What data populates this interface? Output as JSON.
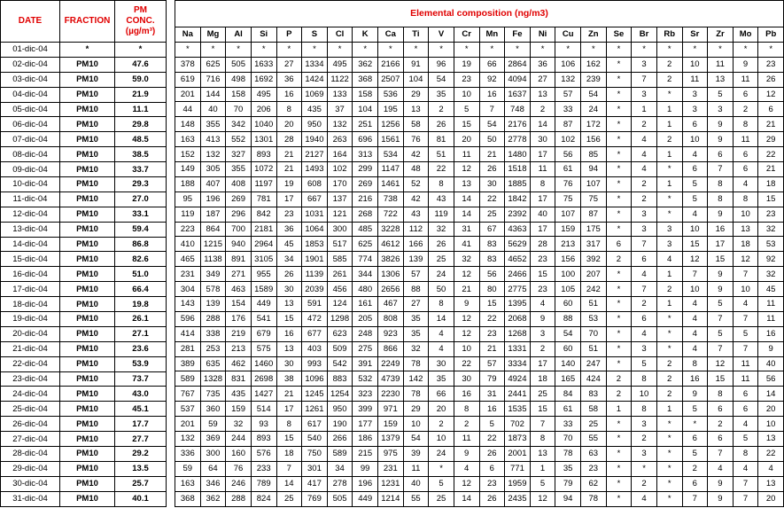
{
  "left_headers": {
    "date": "DATE",
    "fraction": "FRACTION",
    "pm_conc_line1": "PM",
    "pm_conc_line2": "CONC.",
    "pm_conc_unit": "(µg/m³)"
  },
  "title": "Elemental composition (ng/m3)",
  "elements": [
    "Na",
    "Mg",
    "Al",
    "Si",
    "P",
    "S",
    "Cl",
    "K",
    "Ca",
    "Ti",
    "V",
    "Cr",
    "Mn",
    "Fe",
    "Ni",
    "Cu",
    "Zn",
    "Se",
    "Br",
    "Rb",
    "Sr",
    "Zr",
    "Mo",
    "Pb"
  ],
  "rows": [
    {
      "date": "01-dic-04",
      "fraction": "*",
      "pm": "*",
      "values": [
        "*",
        "*",
        "*",
        "*",
        "*",
        "*",
        "*",
        "*",
        "*",
        "*",
        "*",
        "*",
        "*",
        "*",
        "*",
        "*",
        "*",
        "*",
        "*",
        "*",
        "*",
        "*",
        "*",
        "*"
      ]
    },
    {
      "date": "02-dic-04",
      "fraction": "PM10",
      "pm": "47.6",
      "values": [
        "378",
        "625",
        "505",
        "1633",
        "27",
        "1334",
        "495",
        "362",
        "2166",
        "91",
        "96",
        "19",
        "66",
        "2864",
        "36",
        "106",
        "162",
        "*",
        "3",
        "2",
        "10",
        "11",
        "9",
        "23"
      ]
    },
    {
      "date": "03-dic-04",
      "fraction": "PM10",
      "pm": "59.0",
      "values": [
        "619",
        "716",
        "498",
        "1692",
        "36",
        "1424",
        "1122",
        "368",
        "2507",
        "104",
        "54",
        "23",
        "92",
        "4094",
        "27",
        "132",
        "239",
        "*",
        "7",
        "2",
        "11",
        "13",
        "11",
        "26"
      ]
    },
    {
      "date": "04-dic-04",
      "fraction": "PM10",
      "pm": "21.9",
      "values": [
        "201",
        "144",
        "158",
        "495",
        "16",
        "1069",
        "133",
        "158",
        "536",
        "29",
        "35",
        "10",
        "16",
        "1637",
        "13",
        "57",
        "54",
        "*",
        "3",
        "*",
        "3",
        "5",
        "6",
        "12"
      ]
    },
    {
      "date": "05-dic-04",
      "fraction": "PM10",
      "pm": "11.1",
      "values": [
        "44",
        "40",
        "70",
        "206",
        "8",
        "435",
        "37",
        "104",
        "195",
        "13",
        "2",
        "5",
        "7",
        "748",
        "2",
        "33",
        "24",
        "*",
        "1",
        "1",
        "3",
        "3",
        "2",
        "6"
      ]
    },
    {
      "date": "06-dic-04",
      "fraction": "PM10",
      "pm": "29.8",
      "values": [
        "148",
        "355",
        "342",
        "1040",
        "20",
        "950",
        "132",
        "251",
        "1256",
        "58",
        "26",
        "15",
        "54",
        "2176",
        "14",
        "87",
        "172",
        "*",
        "2",
        "1",
        "6",
        "9",
        "8",
        "21"
      ]
    },
    {
      "date": "07-dic-04",
      "fraction": "PM10",
      "pm": "48.5",
      "values": [
        "163",
        "413",
        "552",
        "1301",
        "28",
        "1940",
        "263",
        "696",
        "1561",
        "76",
        "81",
        "20",
        "50",
        "2778",
        "30",
        "102",
        "156",
        "*",
        "4",
        "2",
        "10",
        "9",
        "11",
        "29"
      ]
    },
    {
      "date": "08-dic-04",
      "fraction": "PM10",
      "pm": "38.5",
      "values": [
        "152",
        "132",
        "327",
        "893",
        "21",
        "2127",
        "164",
        "313",
        "534",
        "42",
        "51",
        "11",
        "21",
        "1480",
        "17",
        "56",
        "85",
        "*",
        "4",
        "1",
        "4",
        "6",
        "6",
        "22"
      ]
    },
    {
      "date": "09-dic-04",
      "fraction": "PM10",
      "pm": "33.7",
      "values": [
        "149",
        "305",
        "355",
        "1072",
        "21",
        "1493",
        "102",
        "299",
        "1147",
        "48",
        "22",
        "12",
        "26",
        "1518",
        "11",
        "61",
        "94",
        "*",
        "4",
        "*",
        "6",
        "7",
        "6",
        "21"
      ]
    },
    {
      "date": "10-dic-04",
      "fraction": "PM10",
      "pm": "29.3",
      "values": [
        "188",
        "407",
        "408",
        "1197",
        "19",
        "608",
        "170",
        "269",
        "1461",
        "52",
        "8",
        "13",
        "30",
        "1885",
        "8",
        "76",
        "107",
        "*",
        "2",
        "1",
        "5",
        "8",
        "4",
        "18"
      ]
    },
    {
      "date": "11-dic-04",
      "fraction": "PM10",
      "pm": "27.0",
      "values": [
        "95",
        "196",
        "269",
        "781",
        "17",
        "667",
        "137",
        "216",
        "738",
        "42",
        "43",
        "14",
        "22",
        "1842",
        "17",
        "75",
        "75",
        "*",
        "2",
        "*",
        "5",
        "8",
        "8",
        "15"
      ]
    },
    {
      "date": "12-dic-04",
      "fraction": "PM10",
      "pm": "33.1",
      "values": [
        "119",
        "187",
        "296",
        "842",
        "23",
        "1031",
        "121",
        "268",
        "722",
        "43",
        "119",
        "14",
        "25",
        "2392",
        "40",
        "107",
        "87",
        "*",
        "3",
        "*",
        "4",
        "9",
        "10",
        "23"
      ]
    },
    {
      "date": "13-dic-04",
      "fraction": "PM10",
      "pm": "59.4",
      "values": [
        "223",
        "864",
        "700",
        "2181",
        "36",
        "1064",
        "300",
        "485",
        "3228",
        "112",
        "32",
        "31",
        "67",
        "4363",
        "17",
        "159",
        "175",
        "*",
        "3",
        "3",
        "10",
        "16",
        "13",
        "32"
      ]
    },
    {
      "date": "14-dic-04",
      "fraction": "PM10",
      "pm": "86.8",
      "values": [
        "410",
        "1215",
        "940",
        "2964",
        "45",
        "1853",
        "517",
        "625",
        "4612",
        "166",
        "26",
        "41",
        "83",
        "5629",
        "28",
        "213",
        "317",
        "6",
        "7",
        "3",
        "15",
        "17",
        "18",
        "53"
      ]
    },
    {
      "date": "15-dic-04",
      "fraction": "PM10",
      "pm": "82.6",
      "values": [
        "465",
        "1138",
        "891",
        "3105",
        "34",
        "1901",
        "585",
        "774",
        "3826",
        "139",
        "25",
        "32",
        "83",
        "4652",
        "23",
        "156",
        "392",
        "2",
        "6",
        "4",
        "12",
        "15",
        "12",
        "92"
      ]
    },
    {
      "date": "16-dic-04",
      "fraction": "PM10",
      "pm": "51.0",
      "values": [
        "231",
        "349",
        "271",
        "955",
        "26",
        "1139",
        "261",
        "344",
        "1306",
        "57",
        "24",
        "12",
        "56",
        "2466",
        "15",
        "100",
        "207",
        "*",
        "4",
        "1",
        "7",
        "9",
        "7",
        "32"
      ]
    },
    {
      "date": "17-dic-04",
      "fraction": "PM10",
      "pm": "66.4",
      "values": [
        "304",
        "578",
        "463",
        "1589",
        "30",
        "2039",
        "456",
        "480",
        "2656",
        "88",
        "50",
        "21",
        "80",
        "2775",
        "23",
        "105",
        "242",
        "*",
        "7",
        "2",
        "10",
        "9",
        "10",
        "45"
      ]
    },
    {
      "date": "18-dic-04",
      "fraction": "PM10",
      "pm": "19.8",
      "values": [
        "143",
        "139",
        "154",
        "449",
        "13",
        "591",
        "124",
        "161",
        "467",
        "27",
        "8",
        "9",
        "15",
        "1395",
        "4",
        "60",
        "51",
        "*",
        "2",
        "1",
        "4",
        "5",
        "4",
        "11"
      ]
    },
    {
      "date": "19-dic-04",
      "fraction": "PM10",
      "pm": "26.1",
      "values": [
        "596",
        "288",
        "176",
        "541",
        "15",
        "472",
        "1298",
        "205",
        "808",
        "35",
        "14",
        "12",
        "22",
        "2068",
        "9",
        "88",
        "53",
        "*",
        "6",
        "*",
        "4",
        "7",
        "7",
        "11"
      ]
    },
    {
      "date": "20-dic-04",
      "fraction": "PM10",
      "pm": "27.1",
      "values": [
        "414",
        "338",
        "219",
        "679",
        "16",
        "677",
        "623",
        "248",
        "923",
        "35",
        "4",
        "12",
        "23",
        "1268",
        "3",
        "54",
        "70",
        "*",
        "4",
        "*",
        "4",
        "5",
        "5",
        "16"
      ]
    },
    {
      "date": "21-dic-04",
      "fraction": "PM10",
      "pm": "23.6",
      "values": [
        "281",
        "253",
        "213",
        "575",
        "13",
        "403",
        "509",
        "275",
        "866",
        "32",
        "4",
        "10",
        "21",
        "1331",
        "2",
        "60",
        "51",
        "*",
        "3",
        "*",
        "4",
        "7",
        "7",
        "9"
      ]
    },
    {
      "date": "22-dic-04",
      "fraction": "PM10",
      "pm": "53.9",
      "values": [
        "389",
        "635",
        "462",
        "1460",
        "30",
        "993",
        "542",
        "391",
        "2249",
        "78",
        "30",
        "22",
        "57",
        "3334",
        "17",
        "140",
        "247",
        "*",
        "5",
        "2",
        "8",
        "12",
        "11",
        "40"
      ]
    },
    {
      "date": "23-dic-04",
      "fraction": "PM10",
      "pm": "73.7",
      "values": [
        "589",
        "1328",
        "831",
        "2698",
        "38",
        "1096",
        "883",
        "532",
        "4739",
        "142",
        "35",
        "30",
        "79",
        "4924",
        "18",
        "165",
        "424",
        "2",
        "8",
        "2",
        "16",
        "15",
        "11",
        "56"
      ]
    },
    {
      "date": "24-dic-04",
      "fraction": "PM10",
      "pm": "43.0",
      "values": [
        "767",
        "735",
        "435",
        "1427",
        "21",
        "1245",
        "1254",
        "323",
        "2230",
        "78",
        "66",
        "16",
        "31",
        "2441",
        "25",
        "84",
        "83",
        "2",
        "10",
        "2",
        "9",
        "8",
        "6",
        "14"
      ]
    },
    {
      "date": "25-dic-04",
      "fraction": "PM10",
      "pm": "45.1",
      "values": [
        "537",
        "360",
        "159",
        "514",
        "17",
        "1261",
        "950",
        "399",
        "971",
        "29",
        "20",
        "8",
        "16",
        "1535",
        "15",
        "61",
        "58",
        "1",
        "8",
        "1",
        "5",
        "6",
        "6",
        "20"
      ]
    },
    {
      "date": "26-dic-04",
      "fraction": "PM10",
      "pm": "17.7",
      "values": [
        "201",
        "59",
        "32",
        "93",
        "8",
        "617",
        "190",
        "177",
        "159",
        "10",
        "2",
        "2",
        "5",
        "702",
        "7",
        "33",
        "25",
        "*",
        "3",
        "*",
        "*",
        "2",
        "4",
        "10"
      ]
    },
    {
      "date": "27-dic-04",
      "fraction": "PM10",
      "pm": "27.7",
      "values": [
        "132",
        "369",
        "244",
        "893",
        "15",
        "540",
        "266",
        "186",
        "1379",
        "54",
        "10",
        "11",
        "22",
        "1873",
        "8",
        "70",
        "55",
        "*",
        "2",
        "*",
        "6",
        "6",
        "5",
        "13"
      ]
    },
    {
      "date": "28-dic-04",
      "fraction": "PM10",
      "pm": "29.2",
      "values": [
        "336",
        "300",
        "160",
        "576",
        "18",
        "750",
        "589",
        "215",
        "975",
        "39",
        "24",
        "9",
        "26",
        "2001",
        "13",
        "78",
        "63",
        "*",
        "3",
        "*",
        "5",
        "7",
        "8",
        "22"
      ]
    },
    {
      "date": "29-dic-04",
      "fraction": "PM10",
      "pm": "13.5",
      "values": [
        "59",
        "64",
        "76",
        "233",
        "7",
        "301",
        "34",
        "99",
        "231",
        "11",
        "*",
        "4",
        "6",
        "771",
        "1",
        "35",
        "23",
        "*",
        "*",
        "*",
        "2",
        "4",
        "4",
        "4"
      ]
    },
    {
      "date": "30-dic-04",
      "fraction": "PM10",
      "pm": "25.7",
      "values": [
        "163",
        "346",
        "246",
        "789",
        "14",
        "417",
        "278",
        "196",
        "1231",
        "40",
        "5",
        "12",
        "23",
        "1959",
        "5",
        "79",
        "62",
        "*",
        "2",
        "*",
        "6",
        "9",
        "7",
        "13"
      ]
    },
    {
      "date": "31-dic-04",
      "fraction": "PM10",
      "pm": "40.1",
      "values": [
        "368",
        "362",
        "288",
        "824",
        "25",
        "769",
        "505",
        "449",
        "1214",
        "55",
        "25",
        "14",
        "26",
        "2435",
        "12",
        "94",
        "78",
        "*",
        "4",
        "*",
        "7",
        "9",
        "7",
        "20"
      ]
    }
  ]
}
